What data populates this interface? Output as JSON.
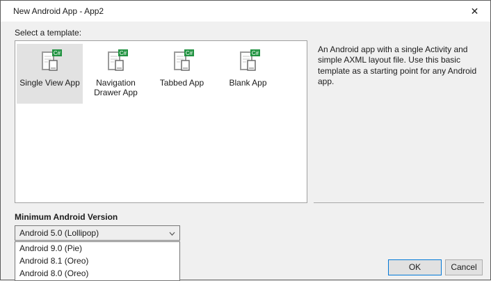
{
  "window": {
    "title": "New Android App - App2"
  },
  "icons": {
    "close": "✕",
    "csharp_badge": "C#"
  },
  "template_section": {
    "label": "Select a template:",
    "items": [
      {
        "label": "Single View App",
        "selected": true
      },
      {
        "label": "Navigation Drawer App",
        "selected": false
      },
      {
        "label": "Tabbed App",
        "selected": false
      },
      {
        "label": "Blank App",
        "selected": false
      }
    ],
    "description": "An Android app with a single Activity and simple AXML layout file. Use this basic template as a starting point for any Android app."
  },
  "min_version": {
    "label": "Minimum Android Version",
    "selected_value": "Android 5.0 (Lollipop)",
    "options": [
      "Android 9.0 (Pie)",
      "Android 8.1 (Oreo)",
      "Android 8.0 (Oreo)"
    ]
  },
  "buttons": {
    "ok": "OK",
    "cancel": "Cancel"
  },
  "colors": {
    "accent": "#0078d7",
    "badge_green": "#229342",
    "selected_item_bg": "#e2e2e2"
  }
}
